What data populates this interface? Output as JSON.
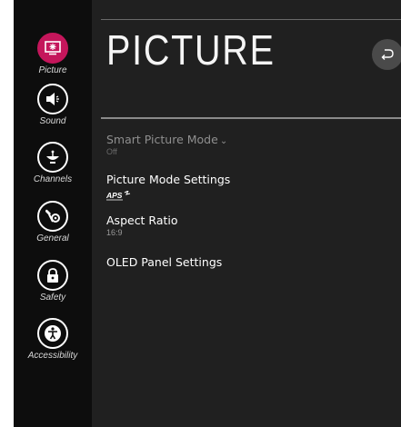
{
  "sidebar": {
    "items": [
      {
        "label": "Picture",
        "icon": "picture-icon",
        "active": true
      },
      {
        "label": "Sound",
        "icon": "speaker-icon"
      },
      {
        "label": "Channels",
        "icon": "satellite-dish-icon"
      },
      {
        "label": "General",
        "icon": "wrench-gear-icon"
      },
      {
        "label": "Safety",
        "icon": "lock-icon"
      },
      {
        "label": "Accessibility",
        "icon": "accessibility-icon"
      }
    ]
  },
  "header": {
    "title": "PICTURE",
    "back_icon": "back-icon"
  },
  "menu": {
    "items": [
      {
        "label": "Smart Picture Mode",
        "value": "Off",
        "disabled": true
      },
      {
        "label": "Picture Mode Settings",
        "badge": "APS"
      },
      {
        "label": "Aspect Ratio",
        "value": "16:9"
      },
      {
        "label": "OLED Panel Settings"
      }
    ]
  },
  "colors": {
    "accent": "#c4165b",
    "background": "#202020",
    "sidebar": "#0d0d0d"
  }
}
